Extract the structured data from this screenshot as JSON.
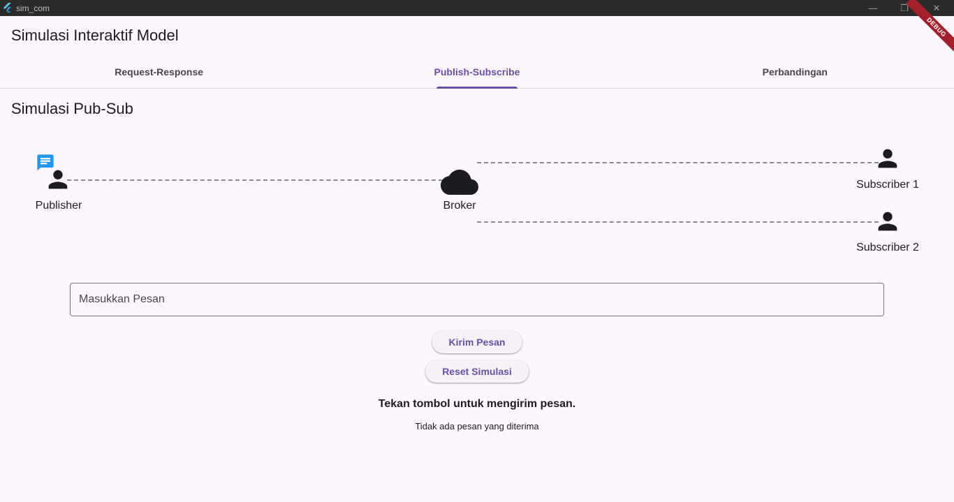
{
  "window": {
    "title": "sim_com",
    "minimize_glyph": "—",
    "restore_glyph": "❐",
    "close_glyph": "✕",
    "debug_banner": "DEBUG"
  },
  "app": {
    "title": "Simulasi Interaktif Model"
  },
  "tabs": [
    {
      "label": "Request-Response",
      "active": false
    },
    {
      "label": "Publish-Subscribe",
      "active": true
    },
    {
      "label": "Perbandingan",
      "active": false
    }
  ],
  "main": {
    "section_title": "Simulasi Pub-Sub",
    "diagram": {
      "publisher": {
        "label": "Publisher",
        "icon": "person-icon",
        "badge_icon": "message-icon"
      },
      "broker": {
        "label": "Broker",
        "icon": "cloud-icon"
      },
      "subscribers": [
        {
          "label": "Subscriber 1",
          "icon": "person-icon"
        },
        {
          "label": "Subscriber 2",
          "icon": "person-icon"
        }
      ]
    },
    "message_input": {
      "placeholder": "Masukkan Pesan",
      "value": ""
    },
    "send_button": "Kirim Pesan",
    "reset_button": "Reset Simulasi",
    "status": "Tekan tombol untuk mengirim pesan.",
    "received": "Tidak ada pesan yang diterima"
  },
  "colors": {
    "background": "#fdf7fd",
    "accent": "#6750a4",
    "message_icon": "#2196f3",
    "titlebar": "#2b2b2b",
    "debug_ribbon": "#a3202a"
  }
}
